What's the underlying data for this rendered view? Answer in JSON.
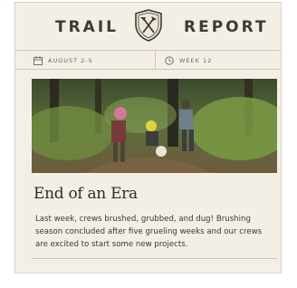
{
  "header": {
    "left_word": "TRAIL",
    "right_word": "REPORT",
    "crest_icon": "shield-crossed-tools-icon"
  },
  "meta": {
    "date_icon": "calendar-icon",
    "date_text": "AUGUST 2-5",
    "week_icon": "clock-icon",
    "week_text": "WEEK 12"
  },
  "article": {
    "photo_alt": "trail crew working",
    "title": "End of an Era",
    "body": "Last week, crews brushed, grubbed, and dug! Brushing season concluded after five grueling weeks and our crews are excited to start some new projects."
  },
  "colors": {
    "background": "#f4efe6",
    "text": "#3d3a33",
    "rule": "#cfc6b6"
  }
}
